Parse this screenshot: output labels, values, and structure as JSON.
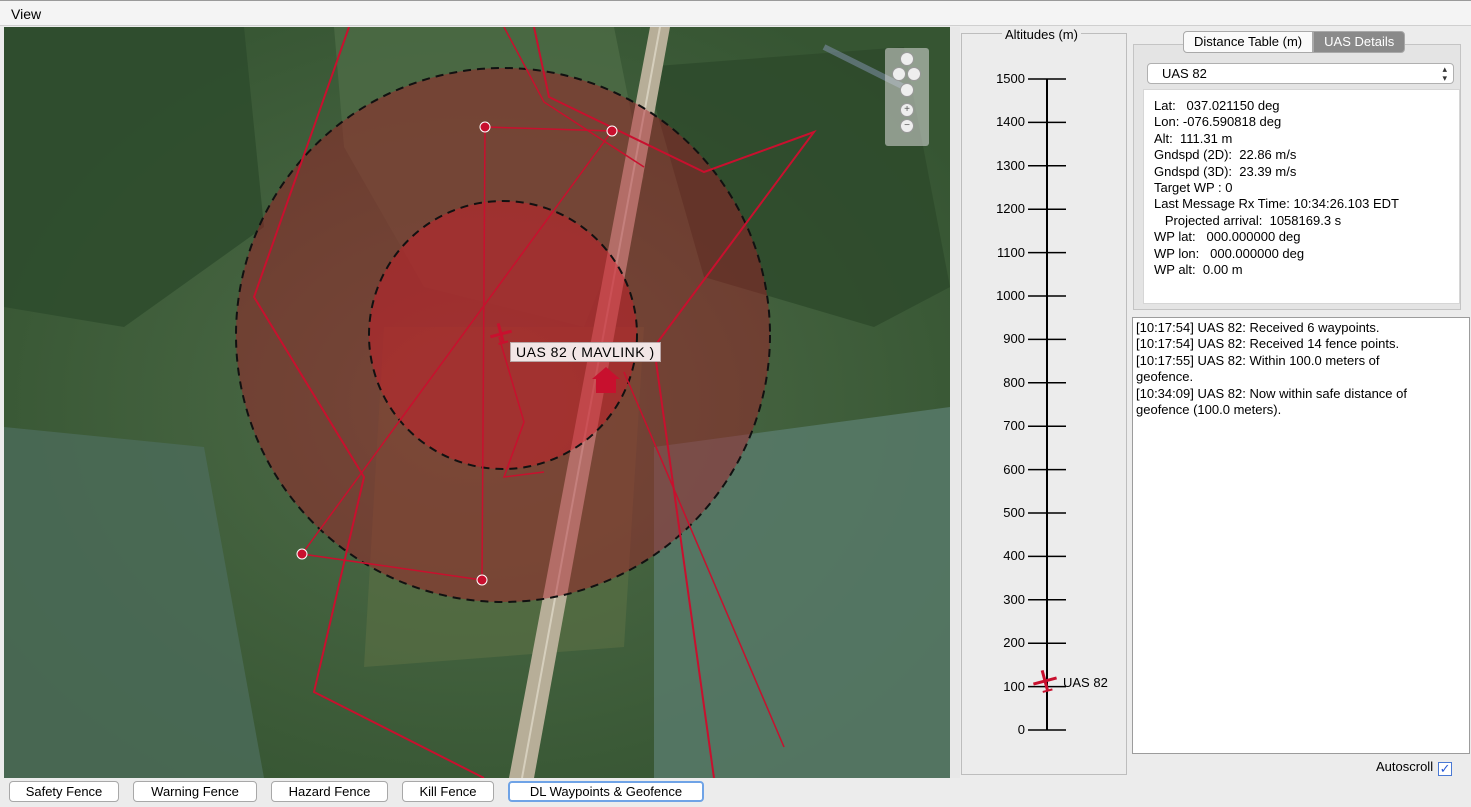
{
  "menu": {
    "view": "View"
  },
  "map": {
    "uas_label": "UAS 82 ( MAVLINK )",
    "zoom_in": "+",
    "zoom_out": "−"
  },
  "altitude_panel": {
    "title": "Altitudes (m)",
    "ticks": [
      "1500",
      "1400",
      "1300",
      "1200",
      "1100",
      "1000",
      "900",
      "800",
      "700",
      "600",
      "500",
      "400",
      "300",
      "200",
      "100",
      "0"
    ],
    "uas_label": "UAS 82",
    "uas_altitude_m": 111.31
  },
  "tabs": {
    "distance_table": "Distance Table (m)",
    "uas_details": "UAS Details"
  },
  "uas_select": {
    "value": "UAS 82"
  },
  "details": {
    "lat": "Lat:   037.021150 deg",
    "lon": "Lon: -076.590818 deg",
    "alt": "Alt:  111.31 m",
    "gndspd2d": "Gndspd (2D):  22.86 m/s",
    "gndspd3d": "Gndspd (3D):  23.39 m/s",
    "target_wp": "Target WP : 0",
    "last_msg": "Last Message Rx Time: 10:34:26.103 EDT",
    "projected": "   Projected arrival:  1058169.3 s",
    "wp_lat": "WP lat:   000.000000 deg",
    "wp_lon": "WP lon:   000.000000 deg",
    "wp_alt": "WP alt:  0.00 m"
  },
  "log": {
    "line1": "[10:17:54] UAS 82: Received 6 waypoints.",
    "line2": "[10:17:54] UAS 82: Received 14 fence points.",
    "line3": "[10:17:55] UAS 82: Within 100.0 meters of",
    "line3b": "geofence.",
    "line4": "[10:34:09] UAS 82: Now within safe distance of",
    "line4b": "geofence (100.0 meters)."
  },
  "autoscroll": {
    "label": "Autoscroll",
    "checked": true,
    "check_glyph": "✓"
  },
  "buttons": {
    "safety": "Safety Fence",
    "warning": "Warning Fence",
    "hazard": "Hazard Fence",
    "kill": "Kill Fence",
    "dl": "DL Waypoints & Geofence"
  },
  "colors": {
    "fence": "#c8102e",
    "accent": "#6fa3e6",
    "tab_active": "#8a8a8a"
  }
}
